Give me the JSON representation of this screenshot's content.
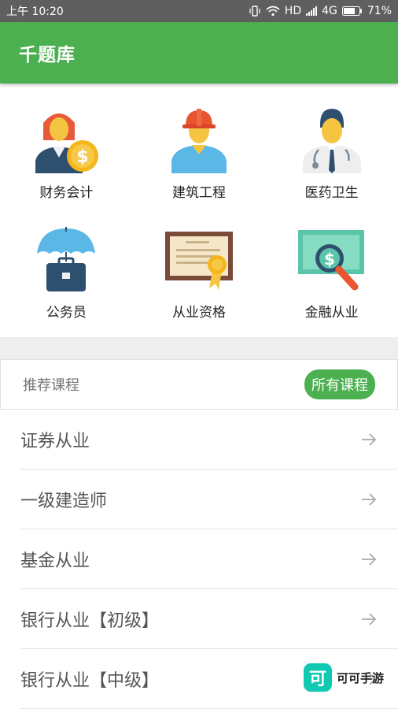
{
  "status_bar": {
    "time": "上午 10:20",
    "network": "HD",
    "signal": "4G",
    "battery": "71%"
  },
  "app_bar": {
    "title": "千题库"
  },
  "categories": [
    {
      "label": "财务会计",
      "icon": "accountant-icon"
    },
    {
      "label": "建筑工程",
      "icon": "construction-worker-icon"
    },
    {
      "label": "医药卫生",
      "icon": "doctor-icon"
    },
    {
      "label": "公务员",
      "icon": "umbrella-briefcase-icon"
    },
    {
      "label": "从业资格",
      "icon": "certificate-icon"
    },
    {
      "label": "金融从业",
      "icon": "money-magnifier-icon"
    }
  ],
  "recommended": {
    "title": "推荐课程",
    "all_button": "所有课程"
  },
  "courses": [
    {
      "label": "证券从业"
    },
    {
      "label": "一级建造师"
    },
    {
      "label": "基金从业"
    },
    {
      "label": "银行从业【初级】"
    },
    {
      "label": "银行从业【中级】"
    }
  ],
  "watermark": {
    "logo_text": "可",
    "text": "可可手游"
  },
  "colors": {
    "primary": "#4caf50",
    "status_bar": "#5f5f5f",
    "watermark": "#10c9b3"
  }
}
